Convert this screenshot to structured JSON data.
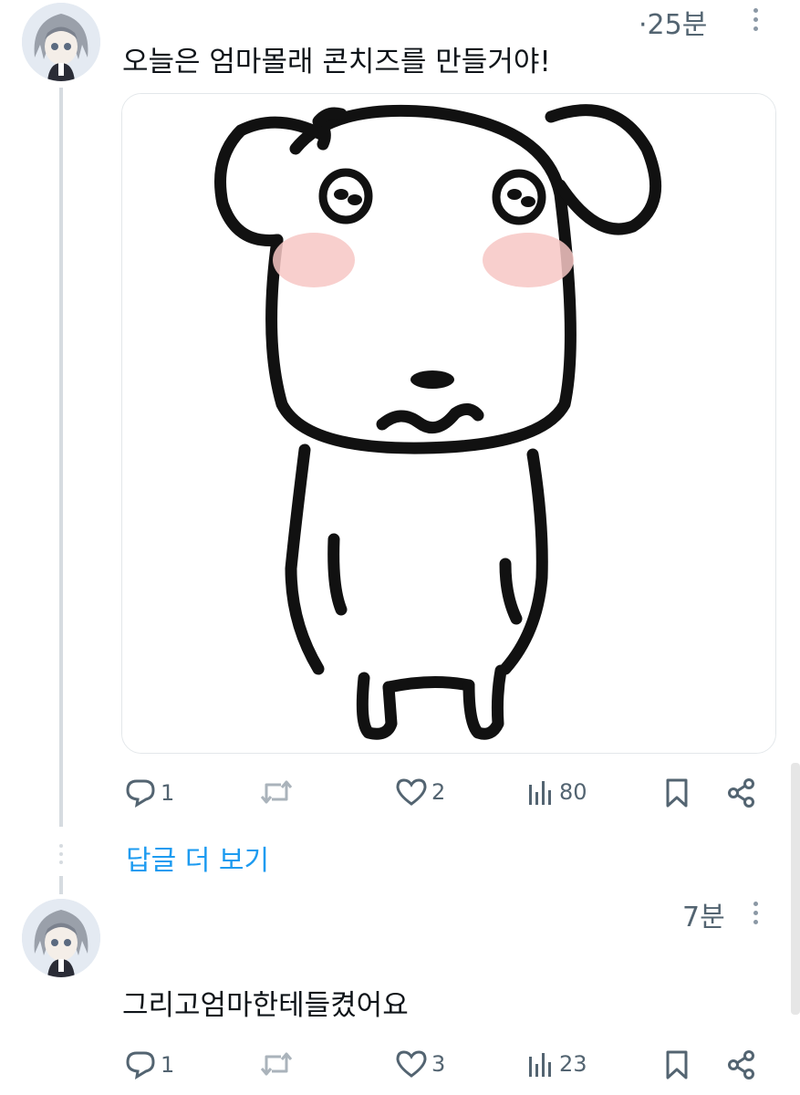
{
  "posts": [
    {
      "time": "·25분",
      "text": "오늘은 엄마몰래 콘치즈를 만들거야!",
      "media_icon": "cartoon-puppy-image",
      "actions": {
        "replies": "1",
        "reposts": "",
        "likes": "2",
        "views": "80"
      }
    },
    {
      "time": "7분",
      "text": "그리고엄마한테들켰어요",
      "actions": {
        "replies": "1",
        "reposts": "",
        "likes": "3",
        "views": "23"
      }
    }
  ],
  "show_more_replies": "답글 더 보기",
  "colors": {
    "link": "#1d9bf0",
    "icon": "#536471",
    "line": "#d6dbe0"
  }
}
